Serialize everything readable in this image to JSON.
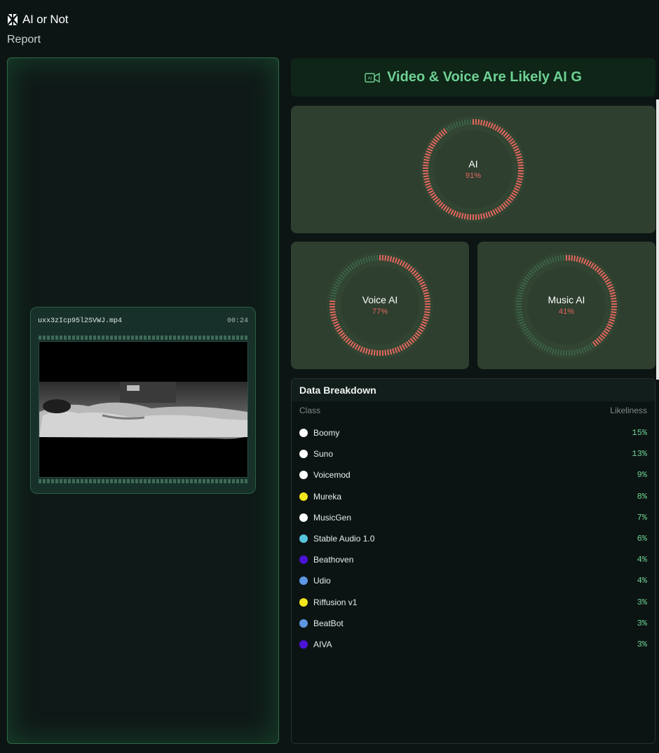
{
  "app": {
    "name": "AI or Not",
    "page_subtitle": "Report"
  },
  "video": {
    "filename": "uxx3zIcp95l2SVWJ.mp4",
    "duration": "00:24"
  },
  "banner": {
    "text": "Video & Voice Are Likely AI G",
    "icon": "video-camera-icon",
    "color": "#6ed194"
  },
  "gauges": {
    "ai": {
      "label": "AI",
      "value_text": "91%",
      "fraction": 0.91
    },
    "voice": {
      "label": "Voice AI",
      "value_text": "77%",
      "fraction": 0.77
    },
    "music": {
      "label": "Music AI",
      "value_text": "41%",
      "fraction": 0.41
    }
  },
  "colors": {
    "accent": "#6ed194",
    "gauge_fill": "#e7675f",
    "gauge_track": "#3f6b4e",
    "card_bg": "#2e3f2f"
  },
  "breakdown": {
    "title": "Data Breakdown",
    "col_class": "Class",
    "col_likeliness": "Likeliness",
    "rows": [
      {
        "name": "Boomy",
        "pct": "15%",
        "color": "#ffffff"
      },
      {
        "name": "Suno",
        "pct": "13%",
        "color": "#ffffff"
      },
      {
        "name": "Voicemod",
        "pct": "9%",
        "color": "#ffffff"
      },
      {
        "name": "Mureka",
        "pct": "8%",
        "color": "#f4e61c"
      },
      {
        "name": "MusicGen",
        "pct": "7%",
        "color": "#ffffff"
      },
      {
        "name": "Stable Audio 1.0",
        "pct": "6%",
        "color": "#57c6dc"
      },
      {
        "name": "Beathoven",
        "pct": "4%",
        "color": "#4b12d8"
      },
      {
        "name": "Udio",
        "pct": "4%",
        "color": "#5e97e2"
      },
      {
        "name": "Riffusion v1",
        "pct": "3%",
        "color": "#f4e61c"
      },
      {
        "name": "BeatBot",
        "pct": "3%",
        "color": "#5e97e2"
      },
      {
        "name": "AIVA",
        "pct": "3%",
        "color": "#4b12d8"
      }
    ]
  }
}
